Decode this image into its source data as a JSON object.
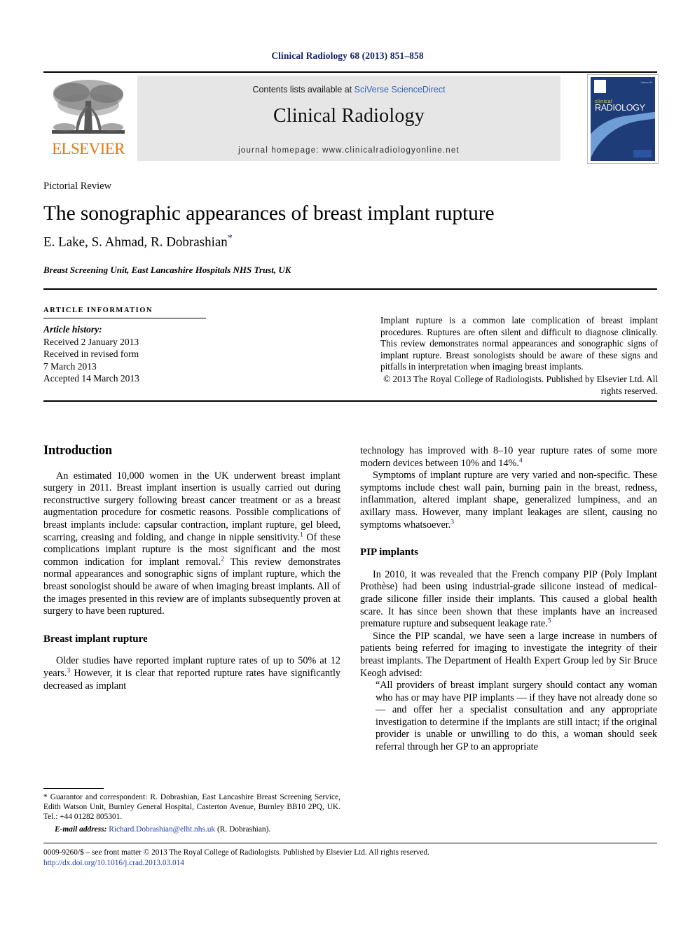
{
  "running_head": "Clinical Radiology 68 (2013) 851–858",
  "masthead": {
    "publisher_name": "ELSEVIER",
    "contents_prefix": "Contents lists available at ",
    "contents_link": "SciVerse ScienceDirect",
    "journal_title": "Clinical Radiology",
    "homepage": "journal homepage: www.clinicalradiologyonline.net",
    "cover": {
      "word_top": "clinical",
      "word_main": "RADIOLOGY",
      "corner_text": "Volume 68"
    }
  },
  "article": {
    "type": "Pictorial Review",
    "title": "The sonographic appearances of breast implant rupture",
    "authors": "E. Lake, S. Ahmad, R. Dobrashian",
    "author_marker": "*",
    "affiliation": "Breast Screening Unit, East Lancashire Hospitals NHS Trust, UK"
  },
  "article_information": {
    "heading": "ARTICLE INFORMATION",
    "history_label": "Article history:",
    "history_lines": [
      "Received 2 January 2013",
      "Received in revised form",
      "7 March 2013",
      "Accepted 14 March 2013"
    ]
  },
  "abstract": {
    "text": "Implant rupture is a common late complication of breast implant procedures. Ruptures are often silent and difficult to diagnose clinically. This review demonstrates normal appearances and sonographic signs of implant rupture. Breast sonologists should be aware of these signs and pitfalls in interpretation when imaging breast implants.",
    "copyright": "© 2013 The Royal College of Radiologists. Published by Elsevier Ltd. All rights reserved."
  },
  "body": {
    "left": {
      "heading_introduction": "Introduction",
      "intro_para_1_a": "An estimated 10,000 women in the UK underwent breast implant surgery in 2011. Breast implant insertion is usually carried out during reconstructive surgery following breast cancer treatment or as a breast augmentation procedure for cosmetic reasons. Possible complications of breast implants include: capsular contraction, implant rupture, gel bleed, scarring, creasing and folding, and change in nipple sensitivity.",
      "ref_1": "1",
      "intro_para_1_b": " Of these complications implant rupture is the most significant and the most common indication for implant removal.",
      "ref_2": "2",
      "intro_para_1_c": " This review demonstrates normal appearances and sonographic signs of implant rupture, which the breast sonologist should be aware of when imaging breast implants. All of the images presented in this review are of implants subsequently proven at surgery to have been ruptured.",
      "heading_rupture": "Breast implant rupture",
      "rupture_para_a": "Older studies have reported implant rupture rates of up to 50% at 12 years.",
      "ref_3": "3",
      "rupture_para_b": " However, it is clear that reported rupture rates have significantly decreased as implant"
    },
    "right": {
      "cont_para_a": "technology has improved with 8–10 year rupture rates of some more modern devices between 10% and 14%.",
      "ref_4": "4",
      "symptoms_para_a": "Symptoms of implant rupture are very varied and non-specific. These symptoms include chest wall pain, burning pain in the breast, redness, inflammation, altered implant shape, generalized lumpiness, and an axillary mass. However, many implant leakages are silent, causing no symptoms whatsoever.",
      "ref_3b": "3",
      "heading_pip": "PIP implants",
      "pip_para_a": "In 2010, it was revealed that the French company PIP (Poly Implant Prothèse) had been using industrial-grade silicone instead of medical-grade silicone filler inside their implants. This caused a global health scare. It has since been shown that these implants have an increased premature rupture and subsequent leakage rate.",
      "ref_5": "5",
      "pip_para_b": "Since the PIP scandal, we have seen a large increase in numbers of patients being referred for imaging to investigate the integrity of their breast implants. The Department of Health Expert Group led by Sir Bruce Keogh advised:",
      "quote": "“All providers of breast implant surgery should contact any woman who has or may have PIP implants — if they have not already done so — and offer her a specialist consultation and any appropriate investigation to determine if the implants are still intact; if the original provider is unable or unwilling to do this, a woman should seek referral through her GP to an appropriate"
    }
  },
  "footnote": {
    "text": "* Guarantor and correspondent: R. Dobrashian, East Lancashire Breast Screening Service, Edith Watson Unit, Burnley General Hospital, Casterton Avenue, Burnley BB10 2PQ, UK. Tel.: +44 01282 805301.",
    "email_label": "E-mail address:",
    "email": "Richard.Dobrashian@elht.nhs.uk",
    "email_suffix": "(R. Dobrashian)."
  },
  "footer": {
    "issn_line": "0009-9260/$ – see front matter © 2013 The Royal College of Radiologists. Published by Elsevier Ltd. All rights reserved.",
    "doi": "http://dx.doi.org/10.1016/j.crad.2013.03.014"
  },
  "colors": {
    "navy": "#14216b",
    "link_blue": "#2040a8",
    "sciencedirect_blue": "#3a62b5",
    "elsevier_orange": "#e8760c",
    "band_grey": "#e6e6e6"
  }
}
